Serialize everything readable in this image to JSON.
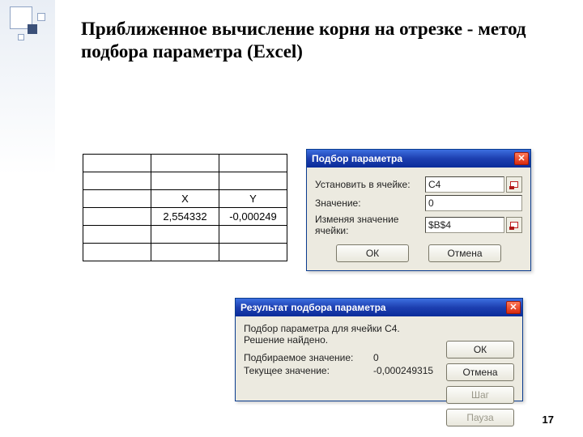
{
  "slide": {
    "title": "Приближенное вычисление корня на отрезке - метод подбора параметра (Excel)",
    "page_number": "17"
  },
  "sheet": {
    "headers": {
      "c1": "X",
      "c2": "Y"
    },
    "row": {
      "x": "2,554332",
      "y": "-0,000249"
    }
  },
  "goalseek": {
    "title": "Подбор параметра",
    "set_cell_label": "Установить в ячейке:",
    "set_cell_value": "C4",
    "to_value_label": "Значение:",
    "to_value_value": "0",
    "by_changing_label": "Изменяя значение ячейки:",
    "by_changing_value": "$B$4",
    "ok": "ОК",
    "cancel": "Отмена"
  },
  "result": {
    "title": "Результат подбора параметра",
    "line1": "Подбор параметра для ячейки C4.",
    "line2": "Решение найдено.",
    "target_label": "Подбираемое значение:",
    "target_value": "0",
    "current_label": "Текущее значение:",
    "current_value": "-0,000249315",
    "ok": "ОК",
    "cancel": "Отмена",
    "step": "Шаг",
    "pause": "Пауза"
  }
}
